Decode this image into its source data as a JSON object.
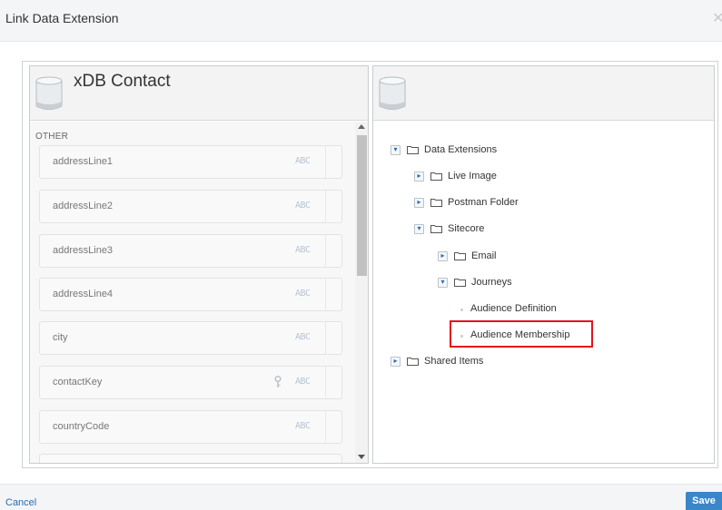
{
  "dialog": {
    "title": "Link Data Extension",
    "close_icon": "close-icon"
  },
  "left_panel": {
    "title": "xDB Contact",
    "section": "OTHER",
    "fields": [
      {
        "name": "addressLine1",
        "type": "ABC",
        "key": false
      },
      {
        "name": "addressLine2",
        "type": "ABC",
        "key": false
      },
      {
        "name": "addressLine3",
        "type": "ABC",
        "key": false
      },
      {
        "name": "addressLine4",
        "type": "ABC",
        "key": false
      },
      {
        "name": "city",
        "type": "ABC",
        "key": false
      },
      {
        "name": "contactKey",
        "type": "ABC",
        "key": true
      },
      {
        "name": "countryCode",
        "type": "ABC",
        "key": false
      }
    ]
  },
  "right_panel": {
    "title": "",
    "tree": {
      "data_extensions": "Data Extensions",
      "live_image": "Live Image",
      "postman_folder": "Postman Folder",
      "sitecore": "Sitecore",
      "email": "Email",
      "journeys": "Journeys",
      "audience_definition": "Audience Definition",
      "audience_membership": "Audience Membership",
      "shared_items": "Shared Items"
    }
  },
  "footer": {
    "cancel_label": "Cancel",
    "save_label": "Save"
  },
  "colors": {
    "accent": "#3b86c9",
    "link": "#2a6bb0",
    "highlight": "#e2141d"
  }
}
